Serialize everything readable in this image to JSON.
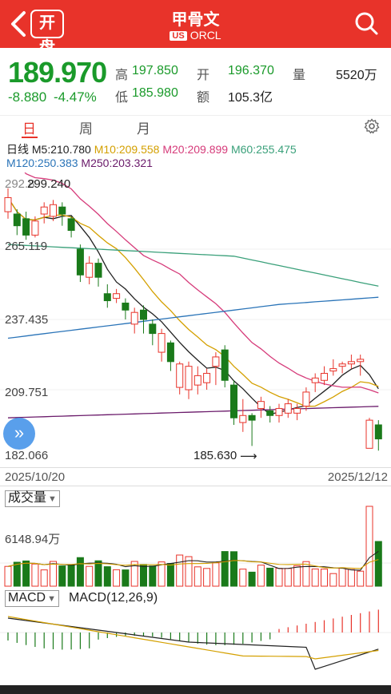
{
  "header": {
    "logo": "开盘",
    "title": "甲骨文",
    "market": "US",
    "ticker": "ORCL"
  },
  "quote": {
    "price": "189.970",
    "change": "-8.880",
    "change_pct": "-4.47%",
    "high_label": "高",
    "high": "197.850",
    "open_label": "开",
    "open": "196.370",
    "volume_label": "量",
    "volume": "5520万",
    "low_label": "低",
    "low": "185.980",
    "amount_label": "额",
    "amount": "105.3亿"
  },
  "tabs": [
    "日",
    "周",
    "月"
  ],
  "ma": {
    "line": "日线",
    "ma5": "M5:210.780",
    "ma10": "M10:209.558",
    "ma20": "M20:209.899",
    "ma60": "M60:255.475",
    "ma120": "M120:250.383",
    "ma250": "M250:203.321"
  },
  "axis": {
    "y1": "292.8",
    "y2": "265.119",
    "y3": "237.435",
    "y4": "209.751",
    "y5": "182.066",
    "high_marker": "299.240",
    "low_marker": "185.630",
    "date_start": "2025/10/20",
    "date_end": "2025/12/12"
  },
  "volume_panel": {
    "selector": "成交量",
    "scale": "6148.94万"
  },
  "macd_panel": {
    "selector": "MACD",
    "params": "MACD(12,26,9)"
  },
  "colors": {
    "brand": "#e8332a",
    "up": "#e8332a",
    "down": "#1a7a1a",
    "ma5": "#222222",
    "ma10": "#d4a000",
    "ma20": "#d63b7a",
    "ma60": "#3aa07a",
    "ma120": "#2a74b8",
    "ma250": "#6a1a6a"
  },
  "chart_data": {
    "type": "candlestick",
    "x_start": "2025/10/20",
    "x_end": "2025/12/12",
    "ylim": [
      182.066,
      292.8
    ],
    "candles": [
      [
        286,
        292,
        296,
        283
      ],
      [
        285,
        280,
        287,
        276
      ],
      [
        283,
        276,
        286,
        274
      ],
      [
        276,
        282,
        284,
        275
      ],
      [
        285,
        288,
        290,
        281
      ],
      [
        284,
        289,
        291,
        282
      ],
      [
        288,
        285,
        290,
        280
      ],
      [
        283,
        278,
        284,
        275
      ],
      [
        270,
        259,
        272,
        256
      ],
      [
        258,
        264,
        267,
        255
      ],
      [
        264,
        258,
        266,
        254
      ],
      [
        251,
        248,
        255,
        245
      ],
      [
        249,
        251,
        253,
        247
      ],
      [
        247,
        244,
        249,
        240
      ],
      [
        238,
        243,
        245,
        234
      ],
      [
        244,
        240,
        246,
        234
      ],
      [
        238,
        234,
        240,
        229
      ],
      [
        226,
        234,
        236,
        222
      ],
      [
        230,
        222,
        231,
        218
      ],
      [
        211,
        221,
        222,
        208
      ],
      [
        210,
        220,
        222,
        206
      ],
      [
        212,
        216,
        220,
        208
      ],
      [
        213,
        217,
        219,
        210
      ],
      [
        220,
        224,
        226,
        212
      ],
      [
        227,
        214,
        229,
        211
      ],
      [
        212,
        198,
        214,
        195
      ],
      [
        196,
        199,
        206,
        192
      ],
      [
        199,
        197,
        200,
        186
      ],
      [
        202,
        205,
        207,
        198
      ],
      [
        201,
        199,
        203,
        196
      ],
      [
        199,
        202,
        204,
        196
      ],
      [
        200,
        204,
        206,
        198
      ],
      [
        200,
        202,
        204,
        197
      ],
      [
        203,
        209,
        211,
        201
      ],
      [
        213,
        215,
        217,
        209
      ],
      [
        214,
        217,
        220,
        212
      ],
      [
        218,
        219,
        223,
        216
      ],
      [
        220,
        221,
        222,
        217
      ],
      [
        221,
        222,
        225,
        219
      ],
      [
        222,
        223,
        225,
        216
      ],
      [
        185,
        197,
        198,
        185
      ],
      [
        195,
        189,
        197,
        184
      ]
    ],
    "volume_scale_label": "6148.94万",
    "macd_params": "MACD(12,26,9)"
  }
}
